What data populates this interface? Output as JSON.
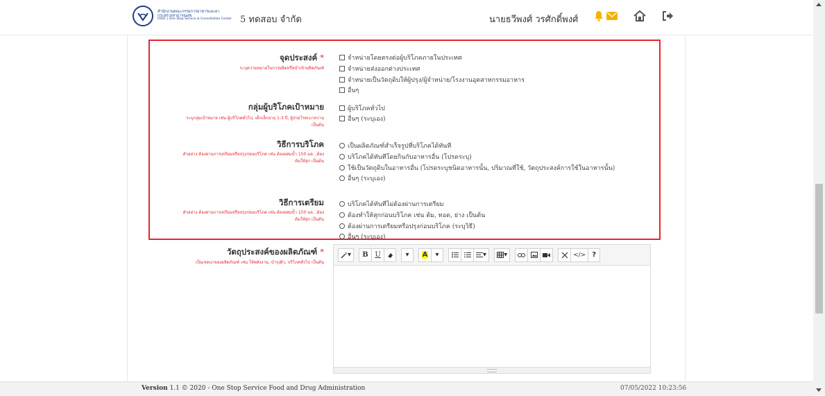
{
  "header": {
    "logo": {
      "line1": "สำนักงานคณะกรรมการอาหารและยา",
      "line2": "กระทรวงสาธารณสุข",
      "line3": "OSSC | One Stop Service & Consultation Center"
    },
    "company": "5 ทดสอบ จำกัด",
    "user_name": "นายธวีพงศ์ วรศักดิ์พงศ์",
    "icons": [
      "bell-icon",
      "mail-icon",
      "home-icon",
      "logout-icon"
    ]
  },
  "form": {
    "purpose": {
      "label": "จุดประสงค์",
      "required": "*",
      "hint": "ระบุความหมายในการผลิตหรือนำเข้าผลิตภัณฑ์",
      "options": [
        "จำหน่ายโดยตรงต่อผู้บริโภคภายในประเทศ",
        "จำหน่ายส่งออกต่างประเทศ",
        "จำหน่ายเป็นวัตถุดิบให้ผู้ปรุง/ผู้จำหน่าย/โรงงานอุตสาหกรรมอาหาร",
        "อื่นๆ"
      ]
    },
    "target_group": {
      "label": "กลุ่มผู้บริโภคเป้าหมาย",
      "hint_lines": [
        "ระบุกลุ่มเป้าหมาย เช่น ผู้บริโภคทั่วไป, เด็กเล็กอายุ 1-3 ปี, ผู้ป่วยโรคเบาหวาน",
        "เป็นต้น"
      ],
      "options": [
        "ผู้บริโภคทั่วไป",
        "อื่นๆ (ระบุเอง)"
      ]
    },
    "consumption": {
      "label": "วิธีการบริโภค",
      "hint_lines": [
        "ตัวอย่าง ต้องผ่านการเตรียมหรือปรุงก่อนบริโภค เช่น ต้องผสมน้ำ 150 มล. ,ต้อง",
        "ต้มให้สุก เป็นต้น"
      ],
      "options": [
        "เป็นผลิตภัณฑ์สำเร็จรูปที่บริโภคได้ทันที",
        "บริโภคได้ทันทีโดยกินกับอาหารอื่น (โปรดระบุ)",
        "ใช้เป็นวัตถุดิบในอาหารอื่น (โปรดระบุชนิดอาหารนั้น, ปริมาณที่ใช้, วัตถุประสงค์การใช้ในอาหารนั้น)",
        "อื่นๆ (ระบุเอง)"
      ]
    },
    "preparation": {
      "label": "วิธีการเตรียม",
      "hint_lines": [
        "ตัวอย่าง ต้องผ่านการเตรียมหรือปรุงก่อนบริโภค เช่น ต้องผสมน้ำ 150 มล. ,ต้อง",
        "ต้มให้สุก เป็นต้น"
      ],
      "options": [
        "บริโภคได้ทันทีไม่ต้องผ่านการเตรียม",
        "ต้องทำให้สุกก่อนบริโภค เช่น ต้ม, ทอด, ย่าง เป็นต้น",
        "ต้องผ่านการเตรียมหรือปรุงก่อนบริโภค (ระบุวิธี)",
        "อื่นๆ (ระบุเอง)"
      ]
    },
    "product_purpose": {
      "label": "วัตถุประสงค์ของผลิตภัณฑ์",
      "required": "*",
      "hint": "เป็นเจตนาของผลิตภัณฑ์ เช่น ให้พลังงาน, บำรุงผิว, บริโภคทั่วไป เป็นต้น"
    }
  },
  "editor": {
    "toolbar": {
      "bold": "B",
      "underline": "U",
      "font_color": "A",
      "help": "?"
    },
    "toolbar_icons": [
      "magic-wand-icon",
      "bold-icon",
      "underline-icon",
      "eraser-icon",
      "font-size-icon",
      "font-color-icon",
      "unordered-list-icon",
      "ordered-list-icon",
      "paragraph-icon",
      "table-icon",
      "link-icon",
      "picture-icon",
      "video-icon",
      "fullscreen-icon",
      "code-view-icon",
      "help-icon"
    ]
  },
  "footer": {
    "version_label": "Version",
    "version_text": "1.1 © 2020 - One Stop Service Food and Drug Administration",
    "datetime": "07/05/2022 10:23:56"
  },
  "colors": {
    "accent_red": "#e3252d",
    "logo_blue": "#1b3f8b",
    "bell_yellow": "#f0b400"
  }
}
